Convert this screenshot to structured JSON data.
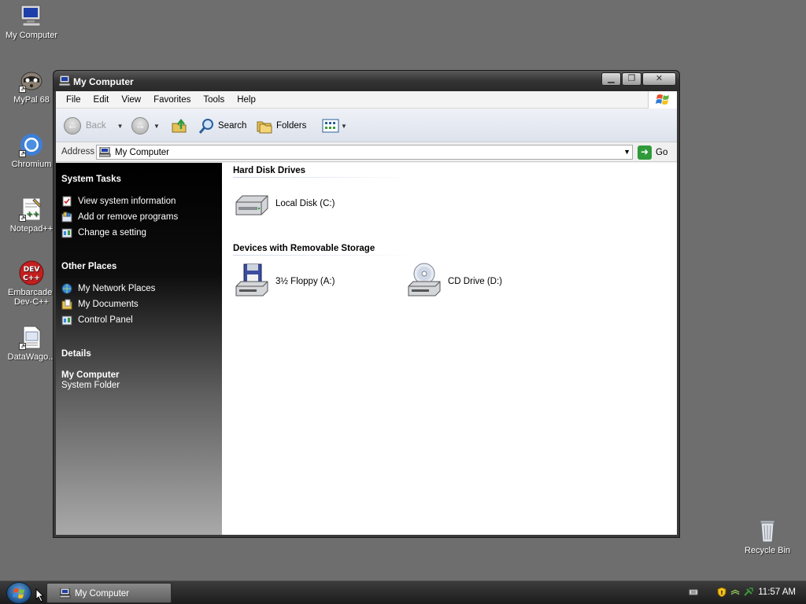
{
  "desktop": {
    "icons": [
      {
        "label": "My Computer",
        "icon": "computer-icon"
      },
      {
        "label": "MyPal 68",
        "icon": "raccoon-browser-icon"
      },
      {
        "label": "Chromium",
        "icon": "chromium-icon"
      },
      {
        "label": "Notepad++",
        "icon": "notepad-plus-plus-icon"
      },
      {
        "label": "Embarcader Dev-C++",
        "icon": "dev-cpp-icon"
      },
      {
        "label": "DataWago...",
        "icon": "document-icon"
      },
      {
        "label": "Recycle Bin",
        "icon": "recycle-bin-icon"
      }
    ]
  },
  "window": {
    "title": "My Computer",
    "menu": [
      "File",
      "Edit",
      "View",
      "Favorites",
      "Tools",
      "Help"
    ],
    "toolbar": {
      "back": "Back",
      "search": "Search",
      "folders": "Folders"
    },
    "address": {
      "label": "Address",
      "value": "My Computer",
      "go": "Go"
    },
    "taskpane": {
      "system_tasks": {
        "title": "System Tasks",
        "items": [
          "View system information",
          "Add or remove programs",
          "Change a setting"
        ]
      },
      "other_places": {
        "title": "Other Places",
        "items": [
          "My Network Places",
          "My Documents",
          "Control Panel"
        ]
      },
      "details": {
        "title": "Details",
        "name": "My Computer",
        "type": "System Folder"
      }
    },
    "content": {
      "groups": [
        {
          "title": "Hard Disk Drives",
          "items": [
            {
              "label": "Local Disk (C:)",
              "icon": "hard-disk-icon"
            }
          ]
        },
        {
          "title": "Devices with Removable Storage",
          "items": [
            {
              "label": "3½ Floppy (A:)",
              "icon": "floppy-drive-icon"
            },
            {
              "label": "CD Drive (D:)",
              "icon": "cd-drive-icon"
            }
          ]
        }
      ]
    }
  },
  "taskbar": {
    "active_window": "My Computer",
    "clock": "11:57 AM"
  },
  "colors": {
    "desktop": "#6e6e6e",
    "taskpane_top": "#000000",
    "taskpane_bottom": "#a9a9a9",
    "go_button": "#2f9a3a"
  }
}
